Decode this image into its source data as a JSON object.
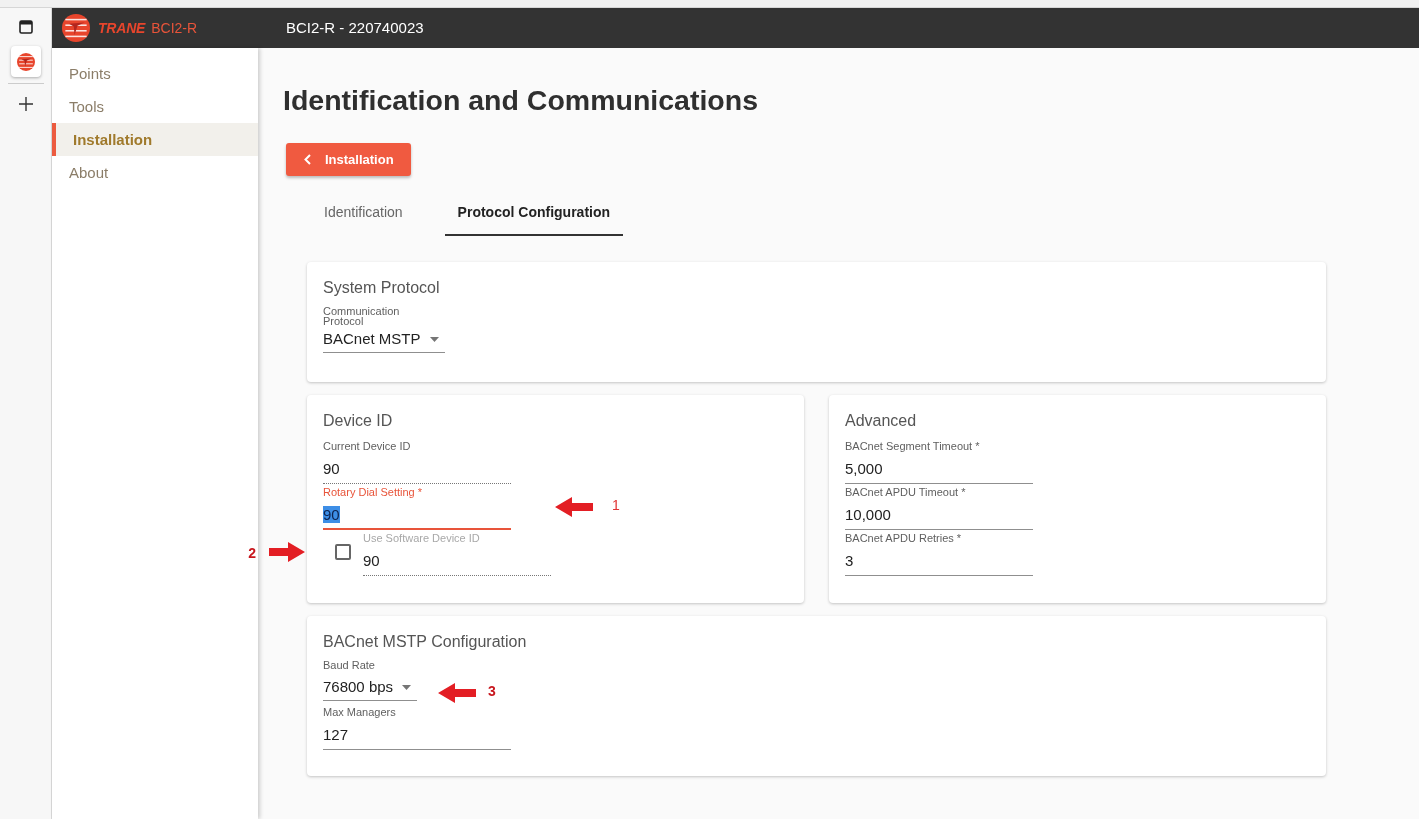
{
  "app_rail": {
    "items": [
      {
        "kind": "panel_toggle",
        "selected": false
      },
      {
        "kind": "app",
        "selected": true
      },
      {
        "kind": "add",
        "selected": false
      }
    ]
  },
  "header": {
    "brand": "TRANE",
    "product": "BCI2-R",
    "title": "BCI2-R - 220740023"
  },
  "sidebar": {
    "items": [
      {
        "label": "Points",
        "selected": false
      },
      {
        "label": "Tools",
        "selected": false
      },
      {
        "label": "Installation",
        "selected": true
      },
      {
        "label": "About",
        "selected": false
      }
    ]
  },
  "page": {
    "title": "Identification and Communications",
    "back_button": {
      "label": "Installation"
    },
    "tabs": [
      {
        "label": "Identification",
        "selected": false
      },
      {
        "label": "Protocol Configuration",
        "selected": true
      }
    ]
  },
  "system_protocol": {
    "title": "System Protocol",
    "fields": [
      {
        "kind": "select",
        "label": "Communication Protocol",
        "value": "BACnet MSTP",
        "disabled": false,
        "focused": false,
        "text_selected": false
      }
    ]
  },
  "device_id": {
    "title": "Device ID",
    "fields": [
      {
        "kind": "text",
        "label": "Current Device ID",
        "value": "90",
        "disabled": true,
        "focused": false,
        "text_selected": false
      },
      {
        "kind": "text",
        "label": "Rotary Dial Setting *",
        "value": "90",
        "disabled": false,
        "focused": true,
        "text_selected": true,
        "annotation": {
          "label": "1",
          "bold": false
        }
      },
      {
        "kind": "checkbox_text",
        "label": "Use Software Device ID",
        "value": "90",
        "checked": false,
        "disabled": true,
        "focused": false,
        "text_selected": false,
        "annotation": {
          "label": "2",
          "bold": true
        }
      }
    ]
  },
  "advanced": {
    "title": "Advanced",
    "fields": [
      {
        "kind": "text",
        "label": "BACnet Segment Timeout *",
        "value": "5,000",
        "disabled": false,
        "focused": false,
        "text_selected": false
      },
      {
        "kind": "text",
        "label": "BACnet APDU Timeout *",
        "value": "10,000",
        "disabled": false,
        "focused": false,
        "text_selected": false
      },
      {
        "kind": "text",
        "label": "BACnet APDU Retries *",
        "value": "3",
        "disabled": false,
        "focused": false,
        "text_selected": false
      }
    ]
  },
  "mstp_configuration": {
    "title": "BACnet MSTP Configuration",
    "fields": [
      {
        "kind": "select",
        "label": "Baud Rate",
        "value": "76800 bps",
        "disabled": false,
        "focused": false,
        "text_selected": false,
        "annotation": {
          "label": "3",
          "bold": true
        }
      },
      {
        "kind": "text",
        "label": "Max Managers",
        "value": "127",
        "disabled": false,
        "focused": false,
        "text_selected": false
      }
    ]
  }
}
